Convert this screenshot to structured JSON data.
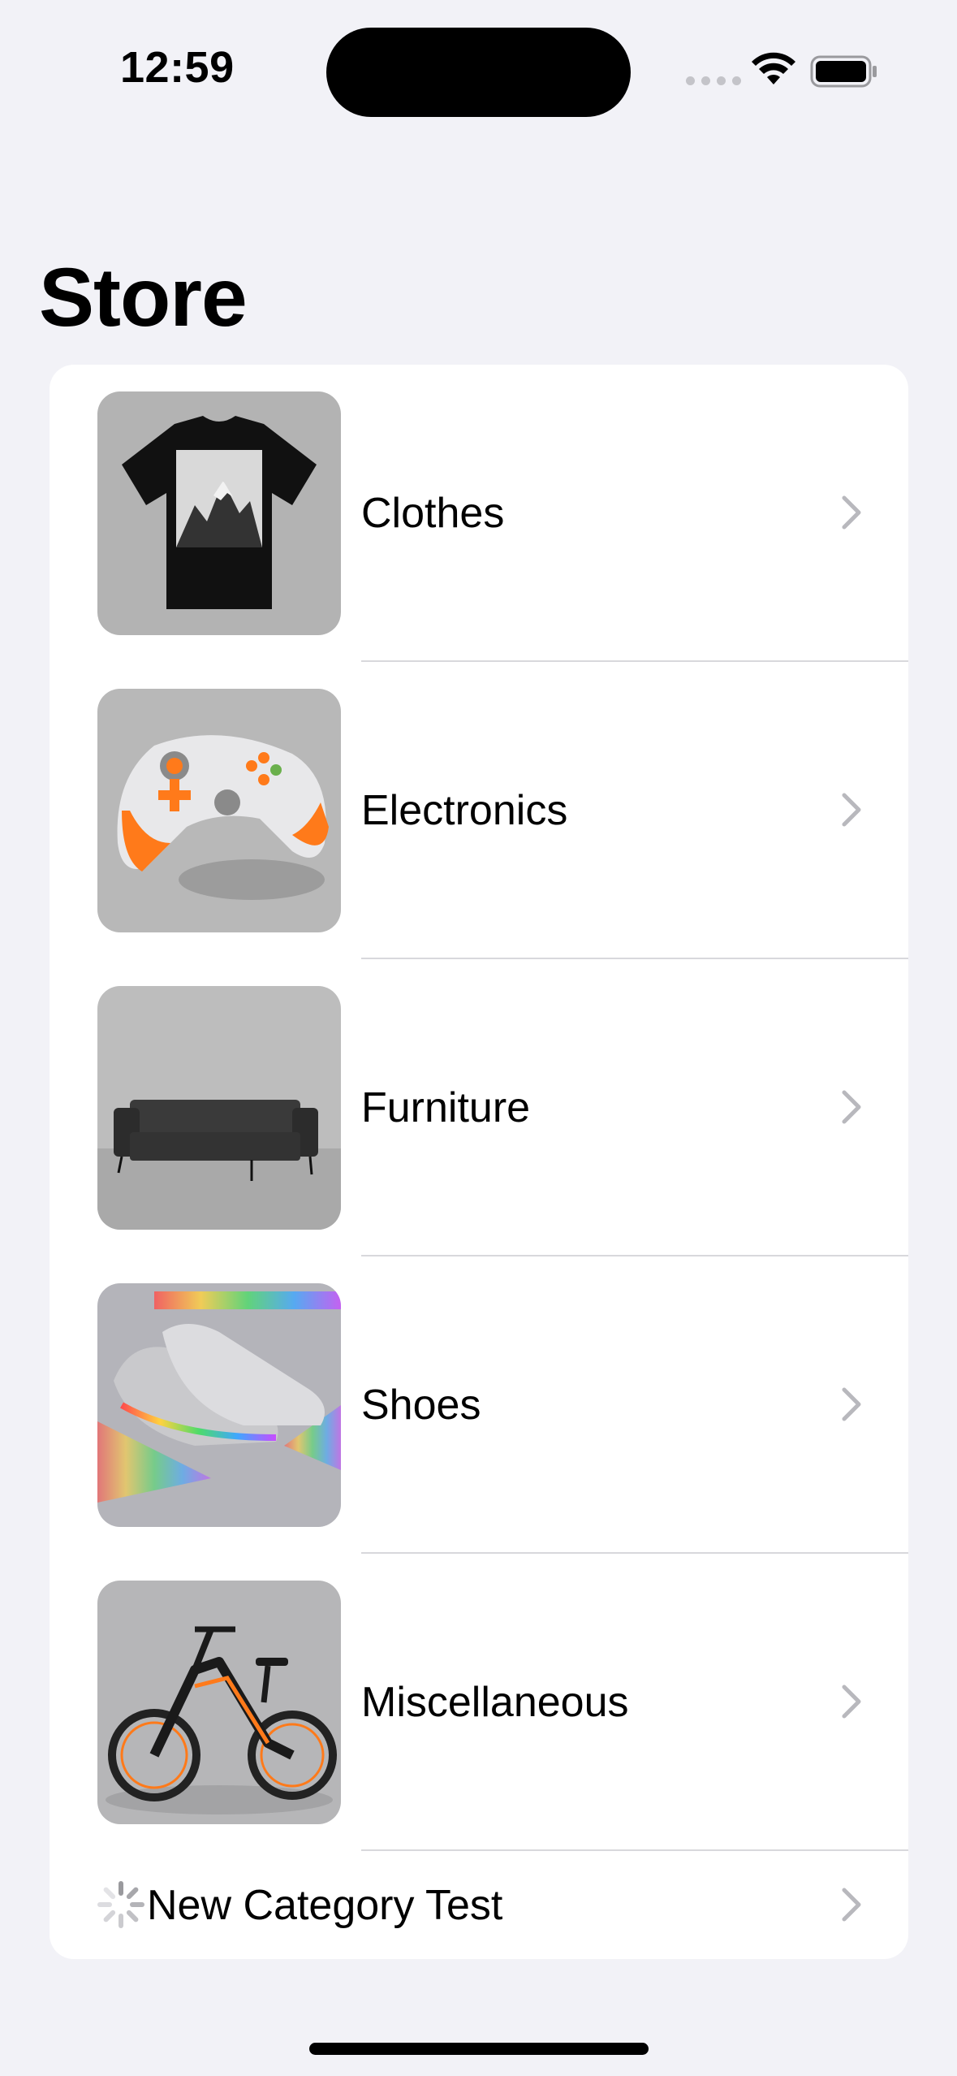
{
  "status_bar": {
    "time": "12:59"
  },
  "page": {
    "title": "Store"
  },
  "categories": [
    {
      "label": "Clothes",
      "icon": "t-shirt-image"
    },
    {
      "label": "Electronics",
      "icon": "game-controller-image"
    },
    {
      "label": "Furniture",
      "icon": "sofa-image"
    },
    {
      "label": "Shoes",
      "icon": "sneakers-image"
    },
    {
      "label": "Miscellaneous",
      "icon": "e-bike-image"
    },
    {
      "label": "New Category Test",
      "icon": "loading-spinner-icon"
    }
  ],
  "colors": {
    "background": "#f2f2f7",
    "chevron": "#b8b8bd",
    "divider": "#d8d8dc"
  }
}
